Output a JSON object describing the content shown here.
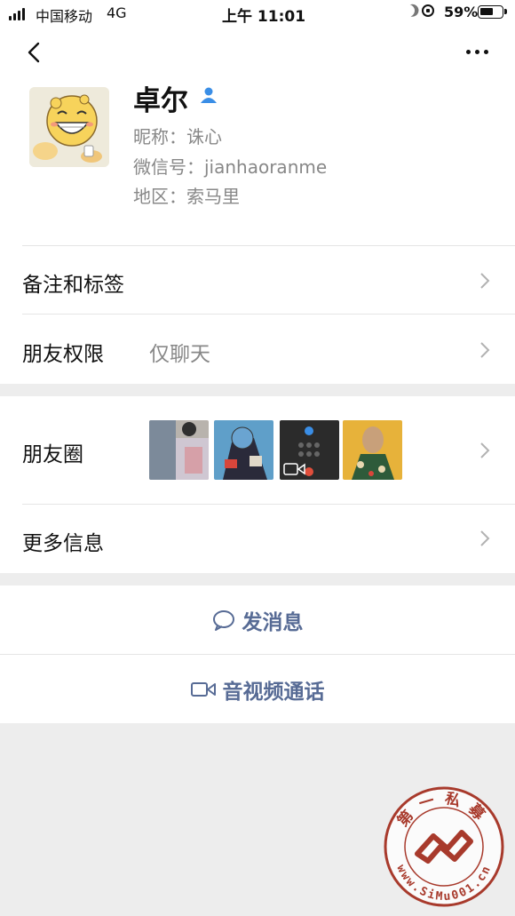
{
  "status": {
    "carrier": "中国移动",
    "network": "4G",
    "time": "上午 11:01",
    "battery": "59%"
  },
  "profile": {
    "name": "卓尔",
    "nickname": "昵称：诛心",
    "wechat_id": "微信号：jianhaoranme",
    "region": "地区：索马里"
  },
  "rows": {
    "remarks_label": "备注和标签",
    "permissions_label": "朋友权限",
    "permissions_value": "仅聊天",
    "moments_label": "朋友圈",
    "more_info_label": "更多信息"
  },
  "actions": {
    "message": "发消息",
    "call": "音视频通话"
  },
  "watermark": {
    "text": "第一私募",
    "url": "www.SiMu001.cn"
  },
  "colors": {
    "link_blue": "#576b95",
    "seal_red": "#a83a2c"
  }
}
